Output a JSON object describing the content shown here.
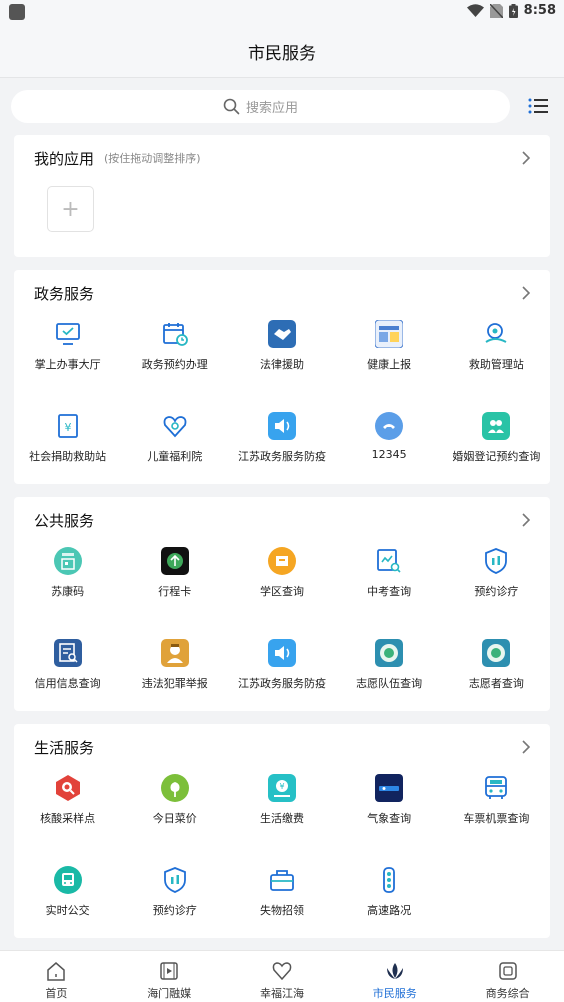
{
  "status_bar": {
    "time": "8:58"
  },
  "header": {
    "title": "市民服务"
  },
  "search": {
    "placeholder": "搜索应用"
  },
  "my_apps": {
    "title": "我的应用",
    "hint": "(按住拖动调整排序)",
    "add_label": "+"
  },
  "sections": [
    {
      "title": "政务服务",
      "items": [
        {
          "label": "掌上办事大厅",
          "icon": "monitor-check-icon"
        },
        {
          "label": "政务预约办理",
          "icon": "calendar-clock-icon"
        },
        {
          "label": "法律援助",
          "icon": "handshake-icon"
        },
        {
          "label": "健康上报",
          "icon": "health-report-icon"
        },
        {
          "label": "救助管理站",
          "icon": "care-hands-icon"
        },
        {
          "label": "社会捐助救助站",
          "icon": "donation-box-icon"
        },
        {
          "label": "儿童福利院",
          "icon": "child-heart-icon"
        },
        {
          "label": "江苏政务服务防疫",
          "icon": "speaker-icon"
        },
        {
          "label": "12345",
          "icon": "hotline-icon"
        },
        {
          "label": "婚姻登记预约查询",
          "icon": "couple-icon"
        }
      ]
    },
    {
      "title": "公共服务",
      "items": [
        {
          "label": "苏康码",
          "icon": "health-code-icon"
        },
        {
          "label": "行程卡",
          "icon": "itinerary-card-icon"
        },
        {
          "label": "学区查询",
          "icon": "school-district-icon"
        },
        {
          "label": "中考查询",
          "icon": "exam-search-icon"
        },
        {
          "label": "预约诊疗",
          "icon": "clinic-shield-icon"
        },
        {
          "label": "信用信息查询",
          "icon": "credit-search-icon"
        },
        {
          "label": "违法犯罪举报",
          "icon": "police-report-icon"
        },
        {
          "label": "江苏政务服务防疫",
          "icon": "speaker-icon"
        },
        {
          "label": "志愿队伍查询",
          "icon": "volunteer-team-icon"
        },
        {
          "label": "志愿者查询",
          "icon": "volunteer-icon"
        }
      ]
    },
    {
      "title": "生活服务",
      "items": [
        {
          "label": "核酸采样点",
          "icon": "nucleic-test-icon"
        },
        {
          "label": "今日菜价",
          "icon": "vegetable-icon"
        },
        {
          "label": "生活缴费",
          "icon": "payment-icon"
        },
        {
          "label": "气象查询",
          "icon": "weather-icon"
        },
        {
          "label": "车票机票查询",
          "icon": "ticket-bus-icon"
        },
        {
          "label": "实时公交",
          "icon": "bus-icon"
        },
        {
          "label": "预约诊疗",
          "icon": "clinic-shield-icon"
        },
        {
          "label": "失物招领",
          "icon": "lost-found-icon"
        },
        {
          "label": "高速路况",
          "icon": "traffic-light-icon"
        }
      ]
    }
  ],
  "bottom_nav": [
    {
      "label": "首页",
      "icon": "home-icon"
    },
    {
      "label": "海门融媒",
      "icon": "media-play-icon"
    },
    {
      "label": "幸福江海",
      "icon": "heart-icon"
    },
    {
      "label": "市民服务",
      "icon": "citizen-service-icon",
      "active": true
    },
    {
      "label": "商务综合",
      "icon": "business-icon"
    }
  ],
  "colors": {
    "accent": "#1f6fd6",
    "background": "#f2f3f5"
  }
}
